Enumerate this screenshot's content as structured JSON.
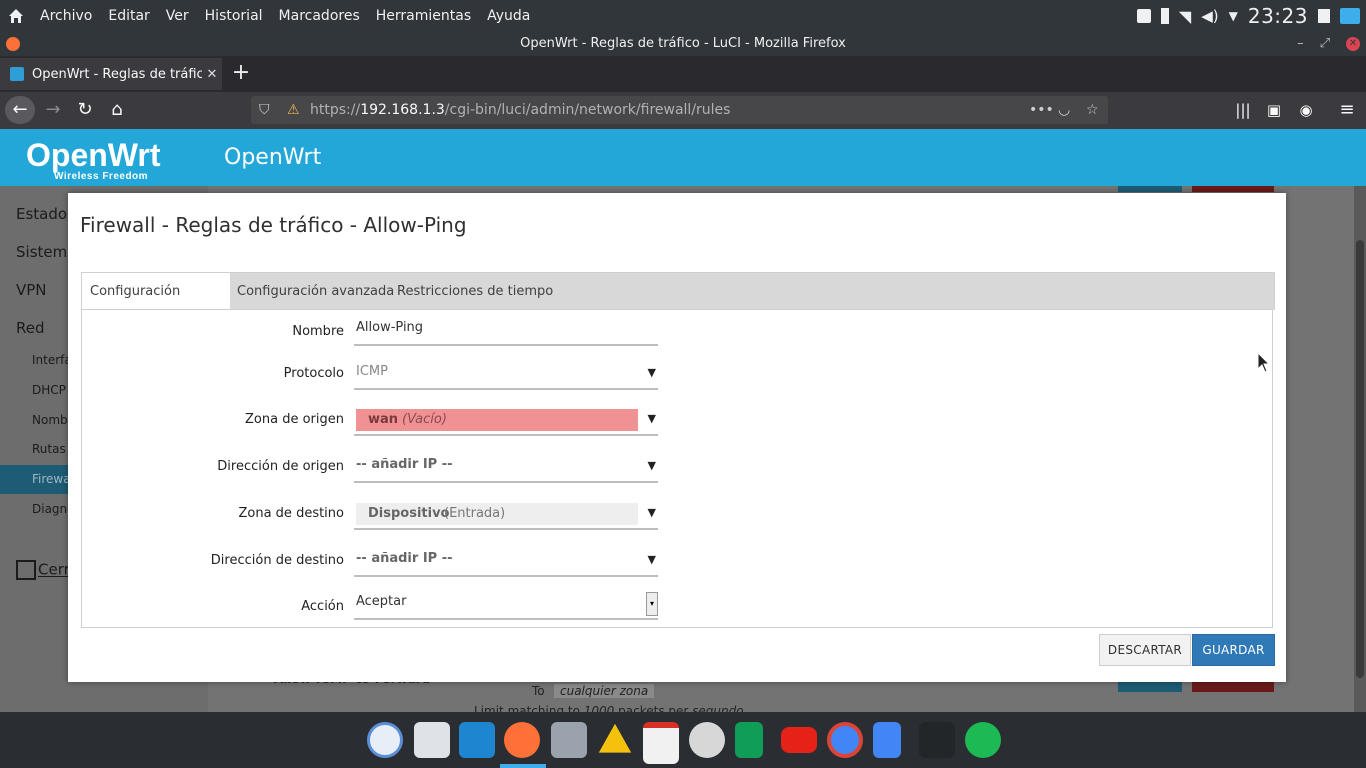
{
  "os_panel": {
    "menu": [
      "Archivo",
      "Editar",
      "Ver",
      "Historial",
      "Marcadores",
      "Herramientas",
      "Ayuda"
    ],
    "clock": "23:23"
  },
  "window": {
    "title": "OpenWrt - Reglas de tráfico - LuCI - Mozilla Firefox"
  },
  "browser": {
    "tab_title": "OpenWrt - Reglas de tráfic",
    "url_prefix": "https://",
    "url_host": "192.168.1.3",
    "url_path": "/cgi-bin/luci/admin/network/firewall/rules"
  },
  "openwrt": {
    "logo_main": "OpenWrt",
    "logo_tagline": "Wireless Freedom",
    "header_title": "OpenWrt",
    "sidebar": {
      "estado": "Estado",
      "sistema": "Sistema",
      "vpn": "VPN",
      "red": "Red",
      "sub": [
        "Interfa",
        "DHCP y",
        "Nombr",
        "Rutas e",
        "Firewa",
        "Diagnó"
      ],
      "logout": "Cerra"
    },
    "background": {
      "rule_name": "Allow-IGMP-to-Forward",
      "to_label": "To",
      "to_zone": "cualquier zona",
      "limit_text": "Limit matching to",
      "limit_num": "1000",
      "limit_rest": "packets per",
      "limit_unit": "segundo"
    }
  },
  "modal": {
    "title": "Firewall - Reglas de tráfico - Allow-Ping",
    "tabs": [
      "Configuración general",
      "Configuración avanzada",
      "Restricciones de tiempo"
    ],
    "fields": {
      "nombre": {
        "label": "Nombre",
        "value": "Allow-Ping"
      },
      "protocolo": {
        "label": "Protocolo",
        "value": "ICMP"
      },
      "zona_origen": {
        "label": "Zona de origen",
        "zone": "wan",
        "note": "(Vacío)",
        "color": "#f09193"
      },
      "direccion_origen": {
        "label": "Dirección de origen",
        "value": "-- añadir IP --"
      },
      "zona_destino": {
        "label": "Zona de destino",
        "zone": "Dispositivo",
        "note": "(Entrada)",
        "color": "#eeeeee"
      },
      "direccion_destino": {
        "label": "Dirección de destino",
        "value": "-- añadir IP --"
      },
      "accion": {
        "label": "Acción",
        "value": "Aceptar"
      }
    },
    "buttons": {
      "discard": "DESCARTAR",
      "save": "GUARDAR"
    }
  },
  "colors": {
    "openwrt_header": "#23a7d8",
    "save_button": "#2f79b7"
  },
  "dock": {
    "apps": [
      "chromium-icon",
      "calculator-icon",
      "wavebox-icon",
      "firefox-icon",
      "files-icon",
      "google-drive-icon",
      "gmail-icon",
      "video-player-icon",
      "sheets-icon",
      "youtube-icon",
      "chrome-icon",
      "docs-icon",
      "terminal-icon",
      "spotify-icon"
    ]
  }
}
